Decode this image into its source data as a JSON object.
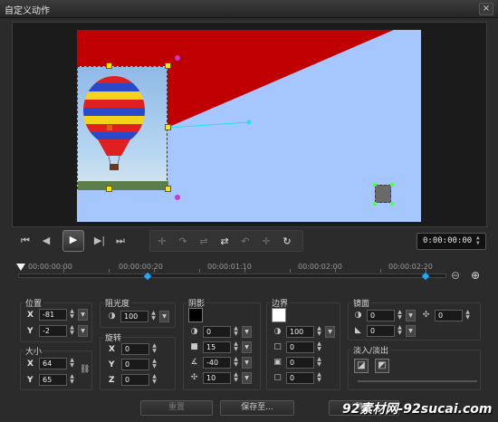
{
  "window": {
    "title": "自定义动作",
    "close_label": "×"
  },
  "transport": {
    "buttons": [
      "⏮",
      "◀",
      "▶",
      "▶|",
      "⏭"
    ],
    "tools": [
      "✛",
      "↷",
      "⇌",
      "⇄",
      "↶",
      "✛",
      "↻"
    ],
    "timecode": "0:00:00:00"
  },
  "ruler": {
    "labels": [
      "00:00:00:00",
      "00:00:00:20",
      "00:00:01:10",
      "00:00:02:00",
      "00:00:02:20"
    ]
  },
  "position": {
    "title": "位置",
    "x_label": "X",
    "x_value": "-81",
    "y_label": "Y",
    "y_value": "-2"
  },
  "size": {
    "title": "大小",
    "x_label": "X",
    "x_value": "64",
    "y_label": "Y",
    "y_value": "65"
  },
  "opacity": {
    "title": "阻光度",
    "value": "100"
  },
  "rotation": {
    "title": "旋转",
    "x_label": "X",
    "x_value": "0",
    "y_label": "Y",
    "y_value": "0",
    "z_label": "Z",
    "z_value": "0"
  },
  "shadow": {
    "title": "阴影",
    "color": "#000000",
    "v1": "0",
    "v2": "15",
    "v3": "-40",
    "v4": "10"
  },
  "border": {
    "title": "边界",
    "color": "#ffffff",
    "v1": "100",
    "v2": "0",
    "v3": "0",
    "v4": "0"
  },
  "mirror": {
    "title": "镜面",
    "v1": "0",
    "v2": "0",
    "v3": "0"
  },
  "fade": {
    "title": "淡入/淡出"
  },
  "buttons": {
    "reset": "重置",
    "save_as": "保存至...",
    "ok": "确定"
  },
  "watermark": "92素材网-92sucai.com",
  "colors": {
    "preview_bg": "#a6c6ff",
    "red_shape": "#c00000",
    "keyframe": "#1fa7ff",
    "handle": "#ffe600"
  }
}
